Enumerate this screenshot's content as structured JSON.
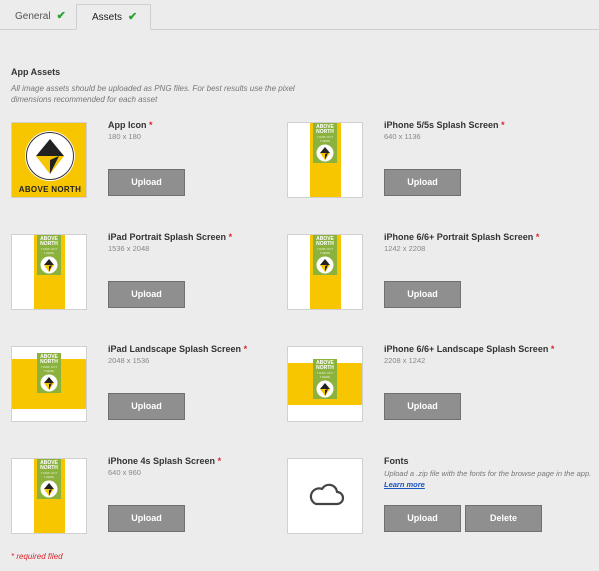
{
  "tabs": [
    {
      "label": "General",
      "check": "✔"
    },
    {
      "label": "Assets",
      "check": "✔"
    }
  ],
  "section": {
    "title": "App Assets",
    "description": "All image assets should be uploaded as PNG files. For best results use the pixel dimensions recommended for each asset"
  },
  "logo_text": {
    "line1": "ABOVE",
    "line2": "NORTH",
    "subline": "THINK OUT THERE",
    "icon_caption": "ABOVE NORTH"
  },
  "assets": {
    "app_icon": {
      "title": "App Icon",
      "dims": "180 x 180"
    },
    "iphone5": {
      "title": "iPhone 5/5s Splash Screen",
      "dims": "640 x 1136"
    },
    "ipad_portrait": {
      "title": "iPad Portrait Splash Screen",
      "dims": "1536 x 2048"
    },
    "iphone6_portrait": {
      "title": "iPhone 6/6+ Portrait Splash Screen",
      "dims": "1242 x 2208"
    },
    "ipad_landscape": {
      "title": "iPad Landscape Splash Screen",
      "dims": "2048 x 1536"
    },
    "iphone6_landscape": {
      "title": "iPhone 6/6+ Landscape Splash Screen",
      "dims": "2208 x 1242"
    },
    "iphone4": {
      "title": "iPhone 4s Splash Screen",
      "dims": "640 x 960"
    },
    "fonts": {
      "title": "Fonts",
      "desc_prefix": "Upload a .zip file with the fonts for the browse page in the app.",
      "learn_more": "Learn more"
    }
  },
  "required_marker": "*",
  "buttons": {
    "upload": "Upload",
    "delete": "Delete"
  },
  "required_note": "* required filed",
  "colors": {
    "brand_yellow": "#f7c600",
    "brand_green": "#8cb23e",
    "button_gray": "#8f8f8f",
    "required_red": "#d9262c",
    "check_green": "#2aa033"
  },
  "icons": {
    "upload_placeholder": "cloud-icon",
    "tab_status": "checkmark-icon"
  }
}
